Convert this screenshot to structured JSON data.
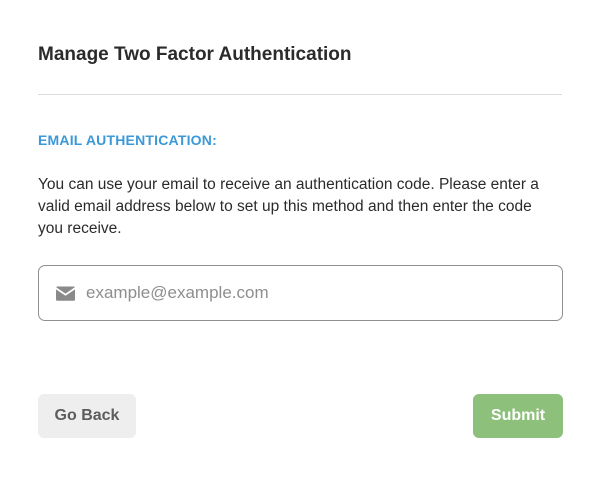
{
  "modal": {
    "title": "Manage Two Factor Authentication"
  },
  "section": {
    "label": "EMAIL AUTHENTICATION:",
    "description": "You can use your email to receive an authentication code. Please enter a valid email address below to set up this method and then enter the code you receive."
  },
  "email_field": {
    "icon": "envelope-icon",
    "value": "",
    "placeholder": "example@example.com"
  },
  "actions": {
    "back_label": "Go Back",
    "submit_label": "Submit"
  },
  "colors": {
    "accent": "#3b99d8",
    "submit": "#8dc07a",
    "back": "#eeeeee"
  }
}
